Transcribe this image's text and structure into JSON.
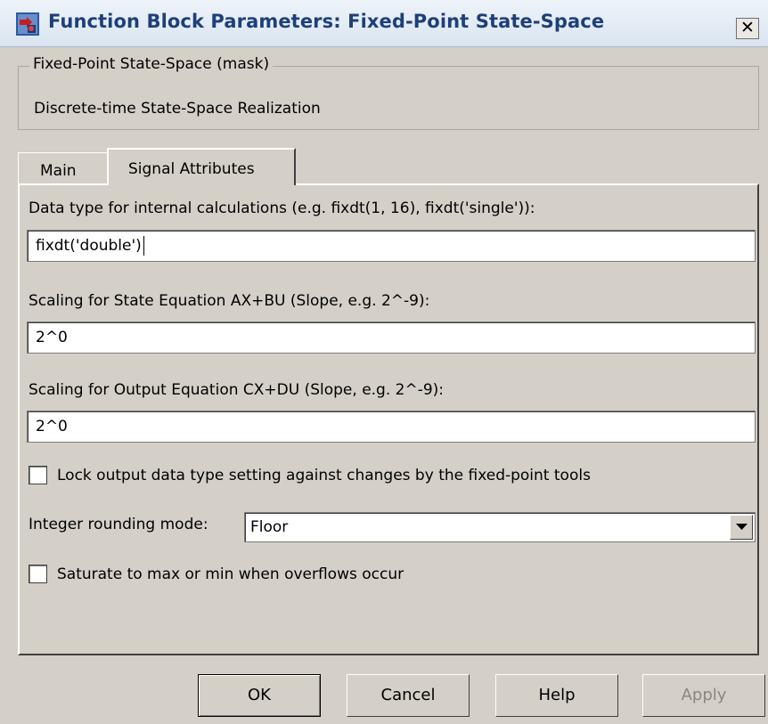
{
  "window": {
    "title": "Function Block Parameters: Fixed-Point State-Space",
    "close_label": "✕"
  },
  "mask": {
    "legend": "Fixed-Point State-Space (mask)",
    "description": "Discrete-time State-Space Realization"
  },
  "tabs": [
    {
      "label": "Main",
      "active": false
    },
    {
      "label": "Signal Attributes",
      "active": true
    }
  ],
  "fields": {
    "data_type": {
      "label": "Data type for internal calculations (e.g. fixdt(1, 16), fixdt('single')):",
      "value": "fixdt('double')"
    },
    "state_scaling": {
      "label": "Scaling for State Equation AX+BU (Slope, e.g. 2^-9):",
      "value": "2^0"
    },
    "output_scaling": {
      "label": "Scaling for Output Equation CX+DU (Slope, e.g. 2^-9):",
      "value": "2^0"
    },
    "lock_output": {
      "label": "Lock output data type setting against changes by the fixed-point tools",
      "checked": false
    },
    "rounding": {
      "label": "Integer rounding mode:",
      "value": "Floor"
    },
    "saturate": {
      "label": "Saturate to max or min when overflows occur",
      "checked": false
    }
  },
  "buttons": {
    "ok": "OK",
    "cancel": "Cancel",
    "help": "Help",
    "apply": "Apply"
  },
  "colors": {
    "dialog_bg": "#d4d0c8",
    "title_text": "#1e3f79",
    "disabled_text": "#8a8782"
  }
}
